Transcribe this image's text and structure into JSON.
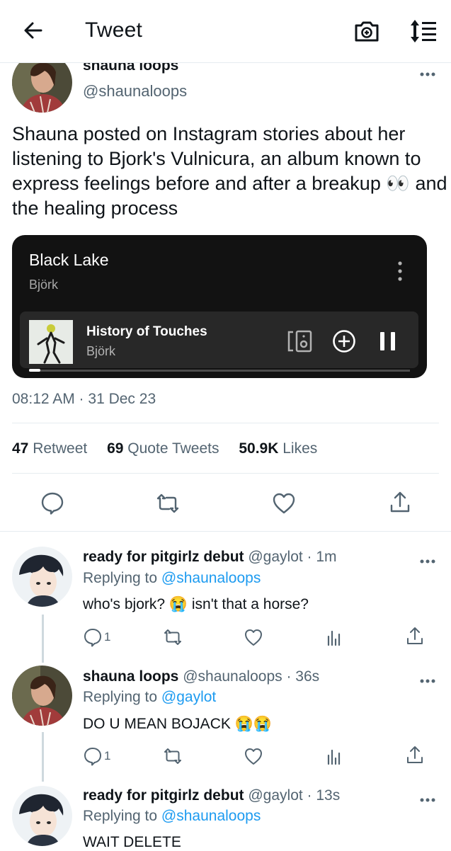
{
  "header": {
    "title": "Tweet"
  },
  "tweet": {
    "display_name": "shauna loops",
    "handle": "@shaunaloops",
    "text": "Shauna posted on Instagram stories about her listening to Bjork's Vulnicura, an album known to express feelings before and after a breakup 👀 and the healing process",
    "timestamp": "08:12 AM · 31 Dec 23",
    "stats": [
      {
        "count": "47",
        "label": "Retweet"
      },
      {
        "count": "69",
        "label": "Quote Tweets"
      },
      {
        "count": "50.9K",
        "label": "Likes"
      }
    ]
  },
  "music_card": {
    "playlist_title": "Black Lake",
    "playlist_artist": "Björk",
    "track_title": "History of Touches",
    "track_artist": "Björk",
    "progress": 0.03,
    "accent": "#121212"
  },
  "replies": [
    {
      "name": "ready for pitgirlz debut",
      "handle_time": "@gaylot · 1m",
      "replying_prefix": "Replying to",
      "replying_to": "@shaunaloops",
      "text": "who's bjork? 😭 isn't that a horse?",
      "reply_count": "1"
    },
    {
      "name": "shauna loops",
      "handle_time": "@shaunaloops · 36s",
      "replying_prefix": "Replying to",
      "replying_to": "@gaylot",
      "text": "DO U MEAN BOJACK 😭😭",
      "reply_count": "1"
    },
    {
      "name": "ready for pitgirlz debut",
      "handle_time": "@gaylot · 13s",
      "replying_prefix": "Replying to",
      "replying_to": "@shaunaloops",
      "text": "WAIT DELETE"
    }
  ],
  "colors": {
    "link": "#1d9bf0",
    "muted": "#536471",
    "text": "#0f1419",
    "divider": "#e6ecf0"
  }
}
